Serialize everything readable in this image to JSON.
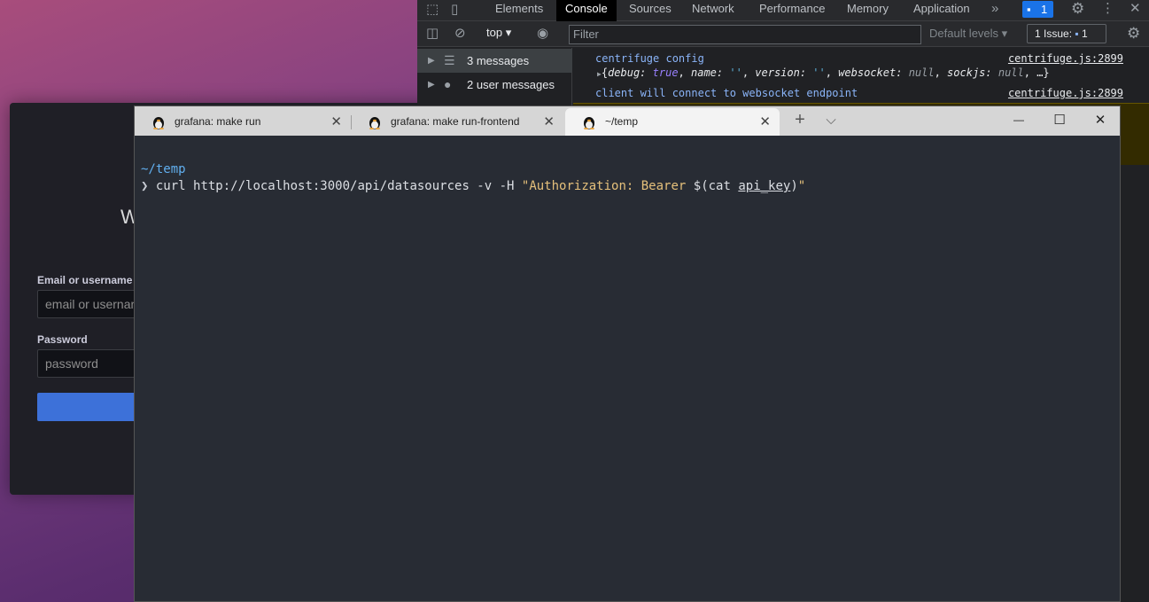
{
  "login": {
    "heading": "W",
    "email_label": "Email or username",
    "email_placeholder": "email or username",
    "password_label": "Password",
    "password_placeholder": "password"
  },
  "devtools": {
    "tabs": [
      "Elements",
      "Console",
      "Sources",
      "Network",
      "Performance",
      "Memory",
      "Application"
    ],
    "active_tab": "Console",
    "more_tabs": "»",
    "issue_badge_count": "1",
    "context": "top",
    "filter_placeholder": "Filter",
    "levels": "Default levels",
    "issues_label": "1 Issue:",
    "issues_count": "1",
    "sidebar": [
      {
        "label": "3 messages",
        "icon": "list-icon"
      },
      {
        "label": "2 user messages",
        "icon": "user-icon"
      }
    ],
    "messages": [
      {
        "text": "centrifuge config",
        "source": "centrifuge.js:2899"
      },
      {
        "text": "client will connect to websocket endpoint",
        "source": "centrifuge.js:2899"
      }
    ],
    "object_preview": {
      "brace_open": "{",
      "k1": "debug: ",
      "v1": "true",
      "k2": "name: ",
      "v2": "''",
      "k3": "version: ",
      "v3": "''",
      "k4": "websocket: ",
      "v4": "null",
      "k5": "sockjs: ",
      "v5": "null",
      "tail": "…}"
    }
  },
  "terminal": {
    "tabs": [
      {
        "label": "grafana: make run"
      },
      {
        "label": "grafana: make run-frontend"
      },
      {
        "label": "~/temp"
      }
    ],
    "active_tab": 2,
    "new_tab": "+",
    "dropdown": "⌵",
    "minimize": "—",
    "maximize": "☐",
    "close": "✕",
    "cwd": "~/temp",
    "prompt_char": "❯",
    "cmd_prefix": "curl http://localhost:3000/api/datasources -v -H ",
    "cmd_str1": "\"Authorization: Bearer ",
    "cmd_sub_open": "$(cat ",
    "cmd_file": "api_key",
    "cmd_sub_close": ")",
    "cmd_str2": "\""
  },
  "colors": {
    "terminal_bg": "#282c34",
    "cwd_blue": "#61afef",
    "string_yellow": "#e5c07b",
    "devtools_bg": "#202124",
    "link_blue": "#8ab4f8",
    "grafana_button": "#3d71d9"
  }
}
